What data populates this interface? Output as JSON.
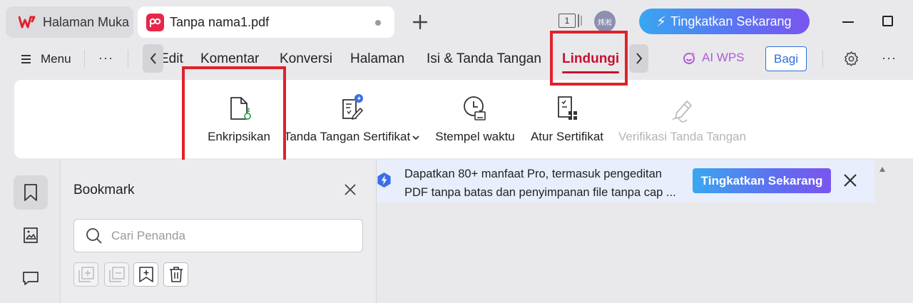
{
  "titlebar": {
    "home_tab_label": "Halaman Muka",
    "doc_tab_label": "Tanpa nama1.pdf",
    "window_count": "1",
    "avatar_text": "炜淞",
    "upgrade_label": "Tingkatkan Sekarang"
  },
  "menubar": {
    "menu_label": "Menu",
    "more_label": "···",
    "tabs": [
      "Edit",
      "Komentar",
      "Konversi",
      "Halaman",
      "Isi & Tanda Tangan",
      "Lindungi"
    ],
    "active_tab": "Lindungi",
    "ai_label": "AI WPS",
    "share_label": "Bagi"
  },
  "ribbon": {
    "tools": [
      {
        "label": "Enkripsikan",
        "icon": "encrypt-icon",
        "enabled": true
      },
      {
        "label": "Tanda Tangan Sertifikat",
        "icon": "certificate-sign-icon",
        "enabled": true,
        "dropdown": true
      },
      {
        "label": "Stempel waktu",
        "icon": "timestamp-icon",
        "enabled": true
      },
      {
        "label": "Atur Sertifikat",
        "icon": "manage-certificate-icon",
        "enabled": true
      },
      {
        "label": "Verifikasi Tanda Tangan",
        "icon": "verify-signature-icon",
        "enabled": false
      }
    ]
  },
  "bookmark_panel": {
    "title": "Bookmark",
    "search_placeholder": "Cari Penanda"
  },
  "promo": {
    "line1": "Dapatkan 80+ manfaat Pro, termasuk pengeditan",
    "line2": "PDF tanpa batas dan penyimpanan file tanpa cap ...",
    "button_label": "Tingkatkan Sekarang"
  },
  "colors": {
    "accent_red": "#c8102e",
    "highlight_red": "#e0222a",
    "brand_blue": "#2b6fdc"
  }
}
